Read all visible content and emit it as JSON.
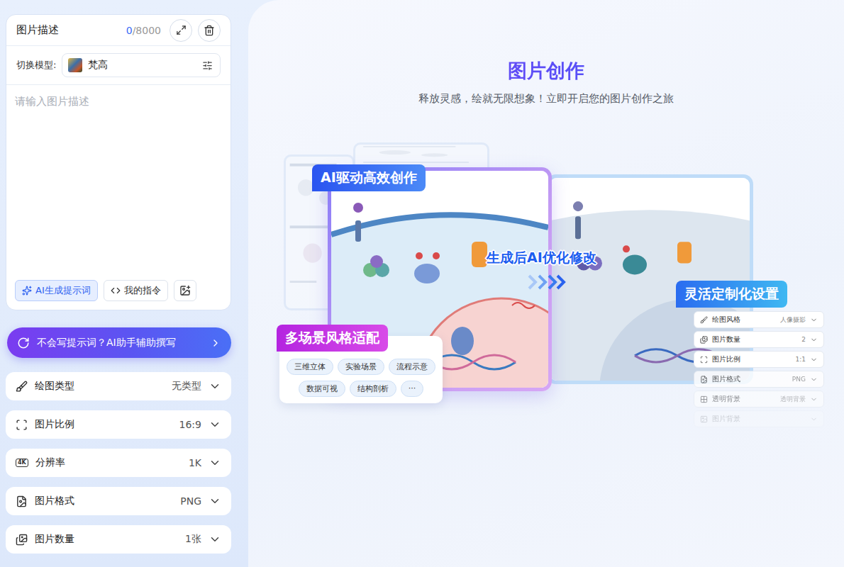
{
  "sidebar": {
    "prompt_card": {
      "title": "图片描述",
      "count": "0",
      "limit": "/8000",
      "model_label": "切换模型:",
      "model": "梵高",
      "placeholder": "请输入图片描述",
      "actions": [
        {
          "label": "AI生成提示词",
          "selected": true
        },
        {
          "label": "我的指令",
          "selected": false
        }
      ]
    },
    "assistant": {
      "label": "不会写提示词？AI助手辅助撰写"
    },
    "options": [
      {
        "label": "绘图类型",
        "value": "无类型"
      },
      {
        "label": "图片比例",
        "value": "16:9"
      },
      {
        "label": "分辨率",
        "value": "1K",
        "badge": "4K"
      },
      {
        "label": "图片格式",
        "value": "PNG"
      },
      {
        "label": "图片数量",
        "value": "1张"
      }
    ]
  },
  "hero": {
    "title": "图片创作",
    "subtitle": "释放灵感，绘就无限想象！立即开启您的图片创作之旅"
  },
  "showcase": {
    "badge_main": "AI驱动高效创作",
    "optimize_label": "生成后AI优化修改",
    "badge_custom": "灵活定制化设置",
    "badge_style": "多场景风格适配",
    "tags": [
      "三维立体",
      "实验场景",
      "流程示意",
      "数据可视",
      "结构剖析",
      "···"
    ],
    "settings": [
      {
        "label": "绘图风格",
        "value": "人像摄影",
        "fade": 0
      },
      {
        "label": "图片数量",
        "value": "2",
        "fade": 0
      },
      {
        "label": "图片比例",
        "value": "1:1",
        "fade": 0
      },
      {
        "label": "图片格式",
        "value": "PNG",
        "fade": 0.2
      },
      {
        "label": "透明背景",
        "value": "透明背景",
        "fade": 0.45
      },
      {
        "label": "图片背景",
        "fade": 0.8
      }
    ]
  }
}
